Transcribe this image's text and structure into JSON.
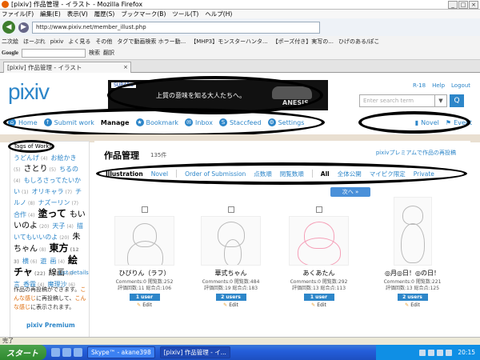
{
  "window": {
    "title": "[pixiv] 作品管理 - イラスト - Mozilla Firefox",
    "min": "_",
    "max": "□",
    "close": "×"
  },
  "menu": [
    "ファイル(F)",
    "編集(E)",
    "表示(V)",
    "履歴(S)",
    "ブックマーク(B)",
    "ツール(T)",
    "ヘルプ(H)"
  ],
  "nav": {
    "back": "◀",
    "forward": "▶",
    "url": "http://www.pixiv.net/member_illust.php"
  },
  "bookmarks": [
    "二次絵",
    "ほーぷれ",
    "pixiv",
    "よく見る",
    "その他",
    "タグで動画検索 ホラー動...",
    "【MHP3】モンスターハンタ...",
    "【ポーズ付き】実写の...",
    "ひげのある/ぽこ"
  ],
  "googlebar": {
    "logo": "Google",
    "search": "検索",
    "translate": "翻訳"
  },
  "tab": {
    "label": "[pixiv] 作品管理 - イラスト",
    "close": "×"
  },
  "pixiv": {
    "logo": "pixiv",
    "ad": {
      "brand": "SUBARU",
      "copy": "上質の意味を知る大人たちへ。",
      "model": "ANESIS"
    },
    "toplinks": [
      "R-18",
      "Help",
      "Logout"
    ],
    "search_placeholder": "Enter search term",
    "search_dd": "▼",
    "search_btn": "Q",
    "mainnav": [
      {
        "label": "Home",
        "icon": "⌂"
      },
      {
        "label": "Submit work",
        "icon": "↑"
      },
      {
        "label": "Manage",
        "icon": ""
      },
      {
        "label": "Bookmark",
        "icon": "★"
      },
      {
        "label": "Inbox",
        "icon": "✉"
      },
      {
        "label": "Staccfeed",
        "icon": "S"
      },
      {
        "label": "Settings",
        "icon": "⚙"
      }
    ],
    "navright": [
      {
        "label": "Novel",
        "icon": "▮"
      },
      {
        "label": "Event",
        "icon": "⚑"
      }
    ]
  },
  "sidebar": {
    "tags_title": "Tags of Works",
    "tags": [
      {
        "t": "うどんげ",
        "c": "(4)",
        "s": ""
      },
      {
        "t": "お絵かき",
        "c": "(5)",
        "s": ""
      },
      {
        "t": "さとり",
        "c": "(5)",
        "s": "mid"
      },
      {
        "t": "ちるの",
        "c": "(4)",
        "s": ""
      },
      {
        "t": "もしろさってたいかい",
        "c": "(1)",
        "s": ""
      },
      {
        "t": "オリキャラ",
        "c": "(7)",
        "s": ""
      },
      {
        "t": "チルノ",
        "c": "(8)",
        "s": ""
      },
      {
        "t": "ナズーリン",
        "c": "(7)",
        "s": ""
      },
      {
        "t": "合作",
        "c": "(4)",
        "s": ""
      },
      {
        "t": "塗って",
        "c": "",
        "s": "big"
      },
      {
        "t": "もいいのよ",
        "c": "(20)",
        "s": "mid"
      },
      {
        "t": "天子",
        "c": "(4)",
        "s": ""
      },
      {
        "t": "描いてもいいのよ",
        "c": "(20)",
        "s": ""
      },
      {
        "t": "朱ちゃん",
        "c": "(8)",
        "s": "mid"
      },
      {
        "t": "東方",
        "c": "(123)",
        "s": "big"
      },
      {
        "t": "横",
        "c": "(6)",
        "s": ""
      },
      {
        "t": "遊",
        "c": "",
        "s": ""
      },
      {
        "t": "画",
        "c": "(4)",
        "s": ""
      },
      {
        "t": "絵チャ",
        "c": "(22)",
        "s": "big"
      },
      {
        "t": "線画",
        "c": "(6)",
        "s": "mid"
      },
      {
        "t": "言",
        "c": "",
        "s": ""
      },
      {
        "t": "香霖",
        "c": "(4)",
        "s": ""
      },
      {
        "t": "魔理沙",
        "c": "(6)",
        "s": ""
      }
    ],
    "list_details": "List details",
    "note_a": "作品の再投稿ができます。",
    "note_hl1": "こんな感じ",
    "note_b": "に再投稿して、",
    "note_hl2": "こんな感じ",
    "note_c": "に表示されます。",
    "premium": "pixiv Premium"
  },
  "content": {
    "title": "作品管理",
    "count": "135件",
    "premium_link": "pixivプレミアムで作品の再投稿",
    "filters_left": [
      "Illustration",
      "Novel",
      "Order of Submission",
      "点数順",
      "閲覧数順"
    ],
    "filters_right": [
      "All",
      "全体公開",
      "マイピク限定",
      "Private"
    ],
    "next": "次へ »",
    "works": [
      {
        "title": "ひびりん（ラフ）",
        "comments": "Comments:0",
        "views": "閲覧数:252",
        "ratings": "評価回数:11",
        "score": "総合点:106",
        "users": "1 user",
        "edit": "Edit"
      },
      {
        "title": "華式ちゃん",
        "comments": "Comments:0",
        "views": "閲覧数:484",
        "ratings": "評価回数:19",
        "score": "総合点:183",
        "users": "2 users",
        "edit": "Edit"
      },
      {
        "title": "あくあたん",
        "comments": "Comments:0",
        "views": "閲覧数:292",
        "ratings": "評価回数:13",
        "score": "総合点:113",
        "users": "1 user",
        "edit": "Edit"
      },
      {
        "title": "◎月◎日！◎の日！",
        "comments": "Comments:0",
        "views": "閲覧数:221",
        "ratings": "評価回数:13",
        "score": "総合点:125",
        "users": "2 users",
        "edit": "Edit"
      }
    ]
  },
  "status": "完了",
  "taskbar": {
    "start": "スタート",
    "tasks": [
      "Skype™ - akane398",
      "[pixiv] 作品管理 - イ..."
    ],
    "clock": "20:15"
  },
  "colors": {
    "pixiv_blue": "#2d86c9",
    "taskbar": "#245edb",
    "start": "#2f8a2f"
  }
}
